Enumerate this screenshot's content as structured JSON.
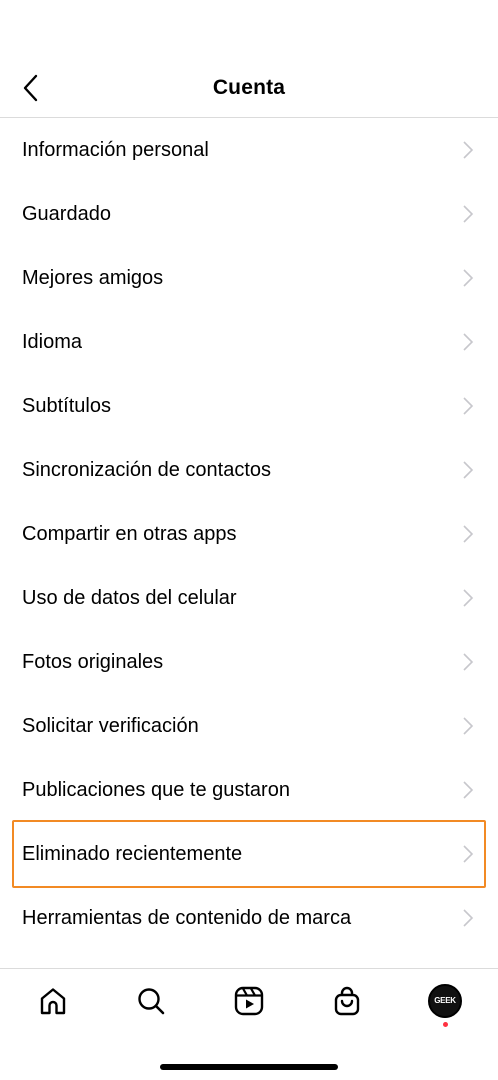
{
  "header": {
    "title": "Cuenta"
  },
  "menu": {
    "items": [
      {
        "label": "Información personal"
      },
      {
        "label": "Guardado"
      },
      {
        "label": "Mejores amigos"
      },
      {
        "label": "Idioma"
      },
      {
        "label": "Subtítulos"
      },
      {
        "label": "Sincronización de contactos"
      },
      {
        "label": "Compartir en otras apps"
      },
      {
        "label": "Uso de datos del celular"
      },
      {
        "label": "Fotos originales"
      },
      {
        "label": "Solicitar verificación"
      },
      {
        "label": "Publicaciones que te gustaron"
      },
      {
        "label": "Eliminado recientemente"
      },
      {
        "label": "Herramientas de contenido de marca"
      }
    ]
  },
  "tabbar": {
    "avatar_text": "GEEK",
    "tabs": [
      "home-icon",
      "search-icon",
      "reels-icon",
      "shop-icon",
      "profile-avatar"
    ]
  },
  "colors": {
    "highlight": "#f28a24",
    "notification": "#ff3040",
    "divider": "#dbdbdb"
  }
}
